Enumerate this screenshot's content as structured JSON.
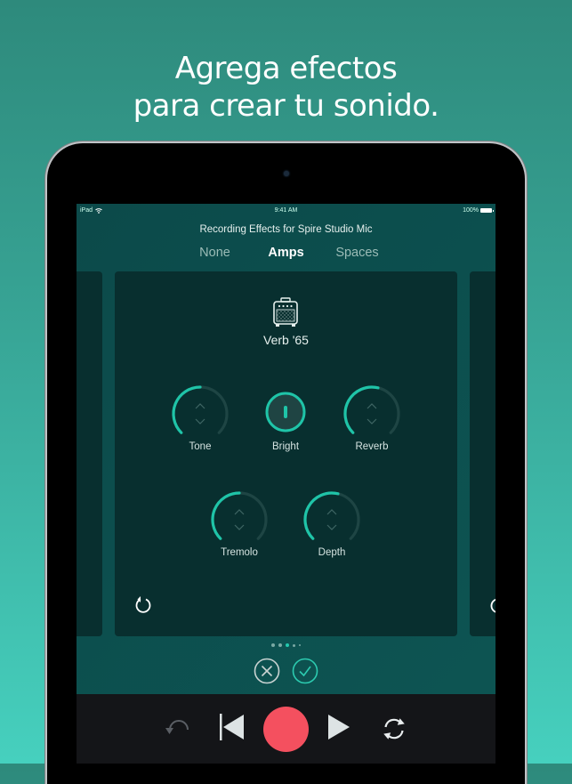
{
  "headline": {
    "line1": "Agrega efectos",
    "line2": "para crear tu sonido."
  },
  "status_bar": {
    "device": "iPad",
    "time": "9:41 AM",
    "battery": "100%"
  },
  "screen": {
    "title": "Recording Effects for Spire Studio Mic",
    "tabs": [
      {
        "label": "None",
        "active": false
      },
      {
        "label": "Amps",
        "active": true
      },
      {
        "label": "Spaces",
        "active": false
      }
    ]
  },
  "effect": {
    "icon": "amplifier-icon",
    "name": "Verb '65",
    "knobs": [
      {
        "label": "Tone",
        "value": 0.5
      },
      {
        "label": "Bright",
        "type": "toggle",
        "on": true
      },
      {
        "label": "Reverb",
        "value": 0.55
      },
      {
        "label": "Tremolo",
        "value": 0.5
      },
      {
        "label": "Depth",
        "value": 0.55
      }
    ]
  },
  "pager": {
    "count": 5,
    "active_index": 2
  },
  "colors": {
    "accent": "#1fc4a8",
    "record": "#f4505f",
    "card": "#082f2f",
    "screen_bg": "#0c4d4c",
    "transport_bg": "#141518"
  },
  "transport": {
    "buttons": [
      "undo-icon",
      "skip-back-icon",
      "record-icon",
      "play-icon",
      "loop-icon"
    ]
  }
}
